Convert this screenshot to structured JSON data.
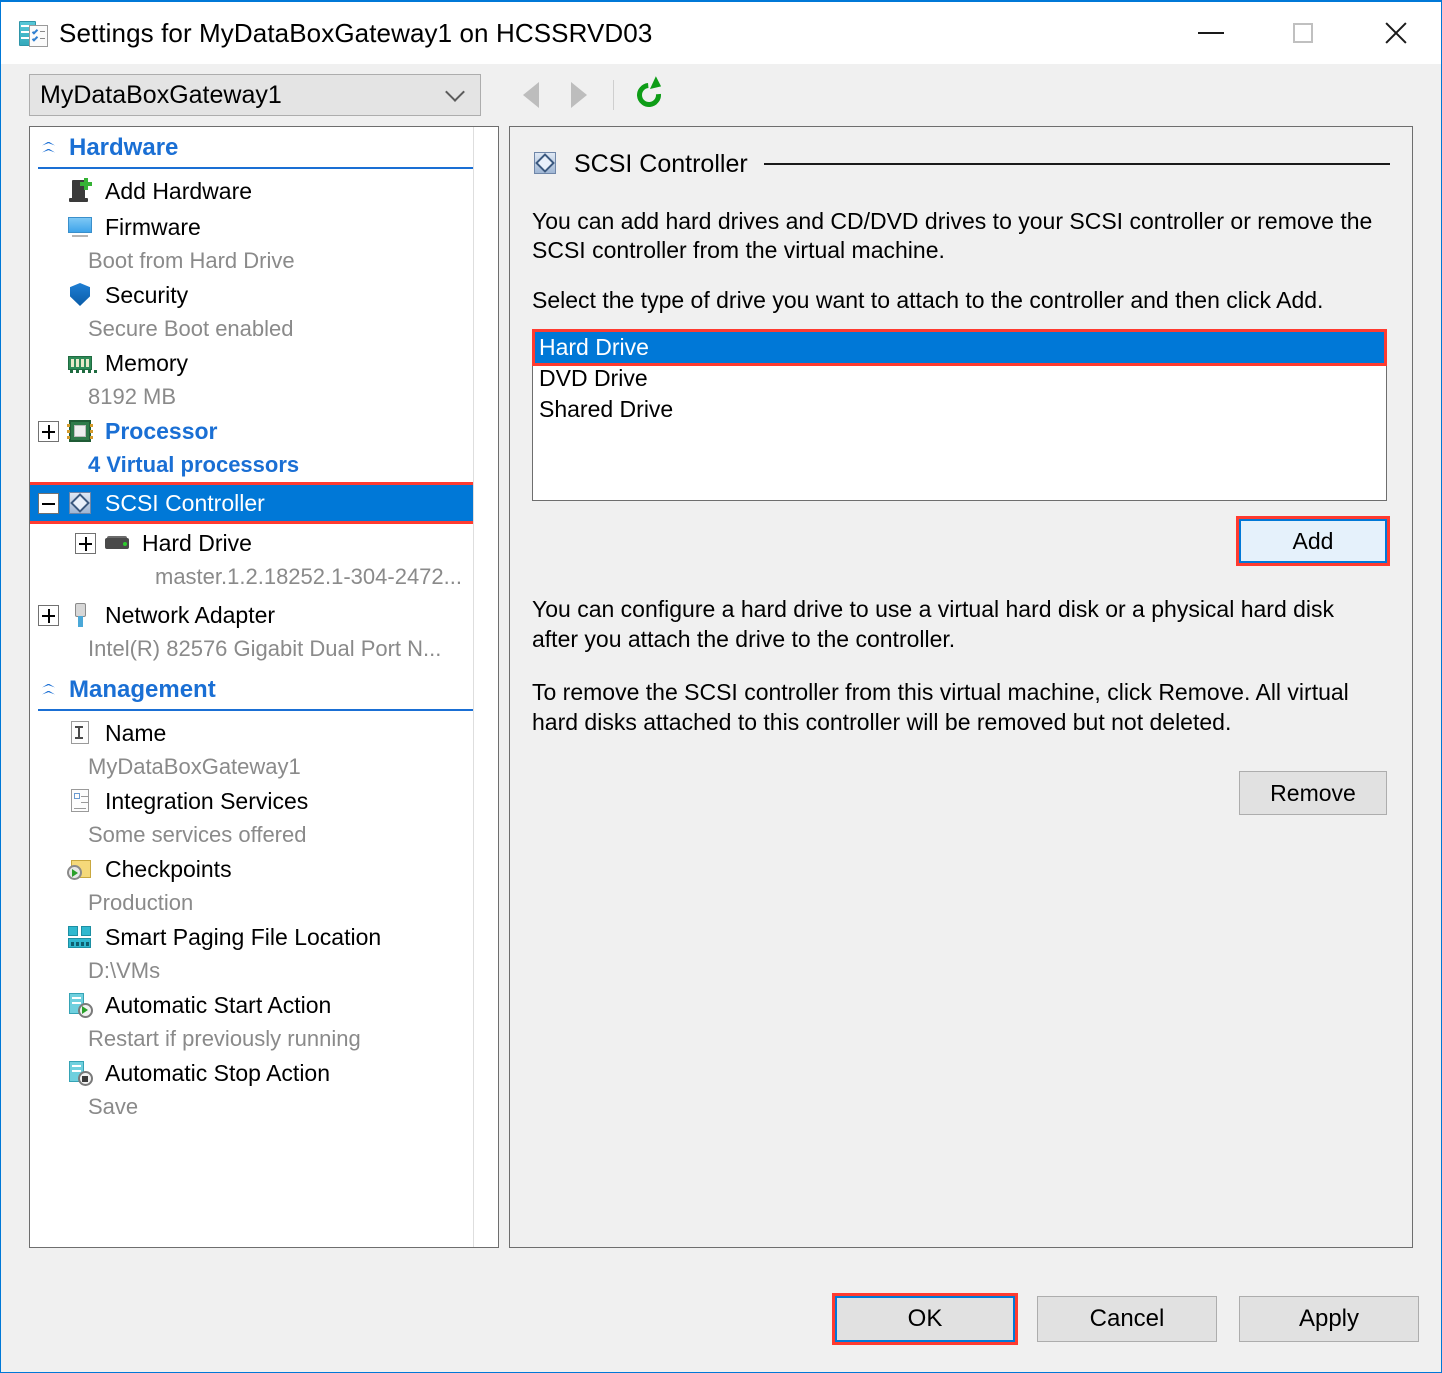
{
  "window": {
    "title": "Settings for MyDataBoxGateway1 on HCSSRVD03",
    "icon": "settings-vm-icon",
    "minimize_label": "Minimize",
    "maximize_label": "Maximize",
    "close_label": "Close"
  },
  "toolbar": {
    "vm_selector_value": "MyDataBoxGateway1",
    "back_label": "Back",
    "forward_label": "Forward",
    "refresh_label": "Refresh"
  },
  "sidebar": {
    "hardware": {
      "title": "Hardware",
      "items": [
        {
          "label": "Add Hardware",
          "sub": "",
          "icon": "add-hardware-icon",
          "expander": "",
          "selected": false
        },
        {
          "label": "Firmware",
          "sub": "Boot from Hard Drive",
          "icon": "firmware-icon",
          "expander": "",
          "selected": false
        },
        {
          "label": "Security",
          "sub": "Secure Boot enabled",
          "icon": "security-shield-icon",
          "expander": "",
          "selected": false
        },
        {
          "label": "Memory",
          "sub": "8192 MB",
          "icon": "memory-icon",
          "expander": "",
          "selected": false
        },
        {
          "label": "Processor",
          "sub": "4 Virtual processors",
          "icon": "processor-icon",
          "expander": "plus",
          "selected": false
        },
        {
          "label": "SCSI Controller",
          "sub": "",
          "icon": "scsi-controller-icon",
          "expander": "minus",
          "selected": true
        },
        {
          "label": "Hard Drive",
          "sub": "master.1.2.18252.1-304-2472...",
          "icon": "hard-drive-icon",
          "expander": "plus",
          "selected": false
        },
        {
          "label": "Network Adapter",
          "sub": "Intel(R) 82576 Gigabit Dual Port N...",
          "icon": "network-adapter-icon",
          "expander": "plus",
          "selected": false
        }
      ]
    },
    "management": {
      "title": "Management",
      "items": [
        {
          "label": "Name",
          "sub": "MyDataBoxGateway1",
          "icon": "name-icon"
        },
        {
          "label": "Integration Services",
          "sub": "Some services offered",
          "icon": "integration-services-icon"
        },
        {
          "label": "Checkpoints",
          "sub": "Production",
          "icon": "checkpoints-icon"
        },
        {
          "label": "Smart Paging File Location",
          "sub": "D:\\VMs",
          "icon": "smart-paging-icon"
        },
        {
          "label": "Automatic Start Action",
          "sub": "Restart if previously running",
          "icon": "auto-start-icon"
        },
        {
          "label": "Automatic Stop Action",
          "sub": "Save",
          "icon": "auto-stop-icon"
        }
      ]
    }
  },
  "main": {
    "panel_title": "SCSI Controller",
    "panel_icon": "scsi-controller-icon",
    "intro_paragraph": "You can add hard drives and CD/DVD drives to your SCSI controller or remove the SCSI controller from the virtual machine.",
    "select_paragraph": "Select the type of drive you want to attach to the controller and then click Add.",
    "drive_types": [
      {
        "label": "Hard Drive",
        "selected": true
      },
      {
        "label": "DVD Drive",
        "selected": false
      },
      {
        "label": "Shared Drive",
        "selected": false
      }
    ],
    "add_button": "Add",
    "configure_paragraph": "You can configure a hard drive to use a virtual hard disk or a physical hard disk after you attach the drive to the controller.",
    "remove_paragraph": "To remove the SCSI controller from this virtual machine, click Remove. All virtual hard disks attached to this controller will be removed but not deleted.",
    "remove_button": "Remove"
  },
  "footer": {
    "ok": "OK",
    "cancel": "Cancel",
    "apply": "Apply"
  },
  "colors": {
    "accent_blue": "#0078d7",
    "header_blue": "#1a6fd4",
    "highlight_red": "#ff3b30",
    "dialog_bg": "#f0f0f0"
  }
}
